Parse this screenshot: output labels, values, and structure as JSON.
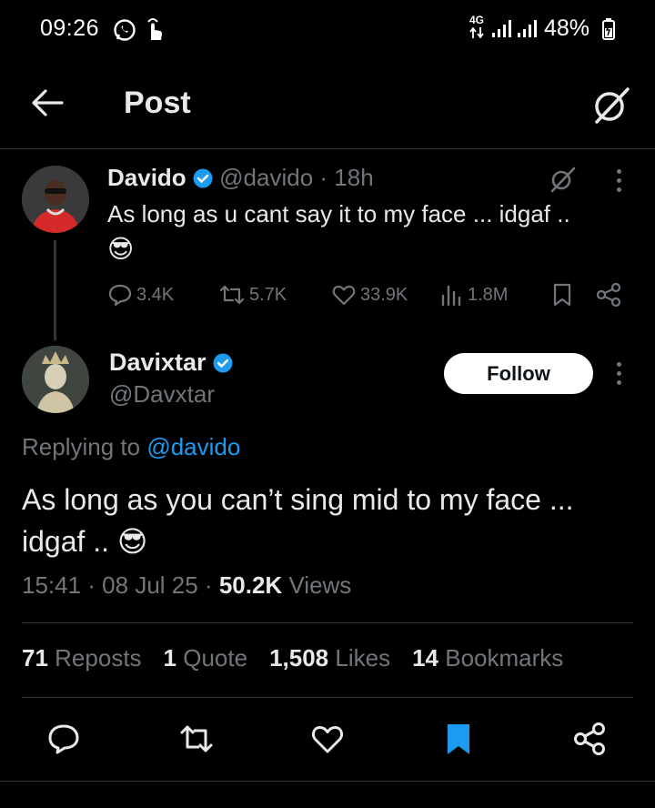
{
  "status_bar": {
    "time": "09:26",
    "network": "4G",
    "battery": "48%"
  },
  "header": {
    "title": "Post"
  },
  "parent_tweet": {
    "name": "Davido",
    "handle": "@davido",
    "time": "· 18h",
    "text": "As long as u cant say it to my face ... idgaf ..",
    "emoji": "😎",
    "replies": "3.4K",
    "reposts": "5.7K",
    "likes": "33.9K",
    "views": "1.8M"
  },
  "main_tweet": {
    "name": "Davixtar",
    "handle": "@Davxtar",
    "follow_label": "Follow",
    "replying_prefix": "Replying to",
    "replying_handle": "@davido",
    "text_line1": "As long as you can’t sing mid to my face ...",
    "text_line2": "idgaf .. ",
    "emoji": "😎",
    "timestamp": "15:41 · 08 Jul 25 · ",
    "views_count": "50.2K",
    "views_label": " Views"
  },
  "engagement": {
    "reposts_count": "71",
    "reposts_label": "Reposts",
    "quotes_count": "1",
    "quotes_label": "Quote",
    "likes_count": "1,508",
    "likes_label": "Likes",
    "bookmarks_count": "14",
    "bookmarks_label": "Bookmarks"
  },
  "colors": {
    "accent": "#1d9bf0",
    "background": "#000000",
    "muted": "#71767b"
  }
}
